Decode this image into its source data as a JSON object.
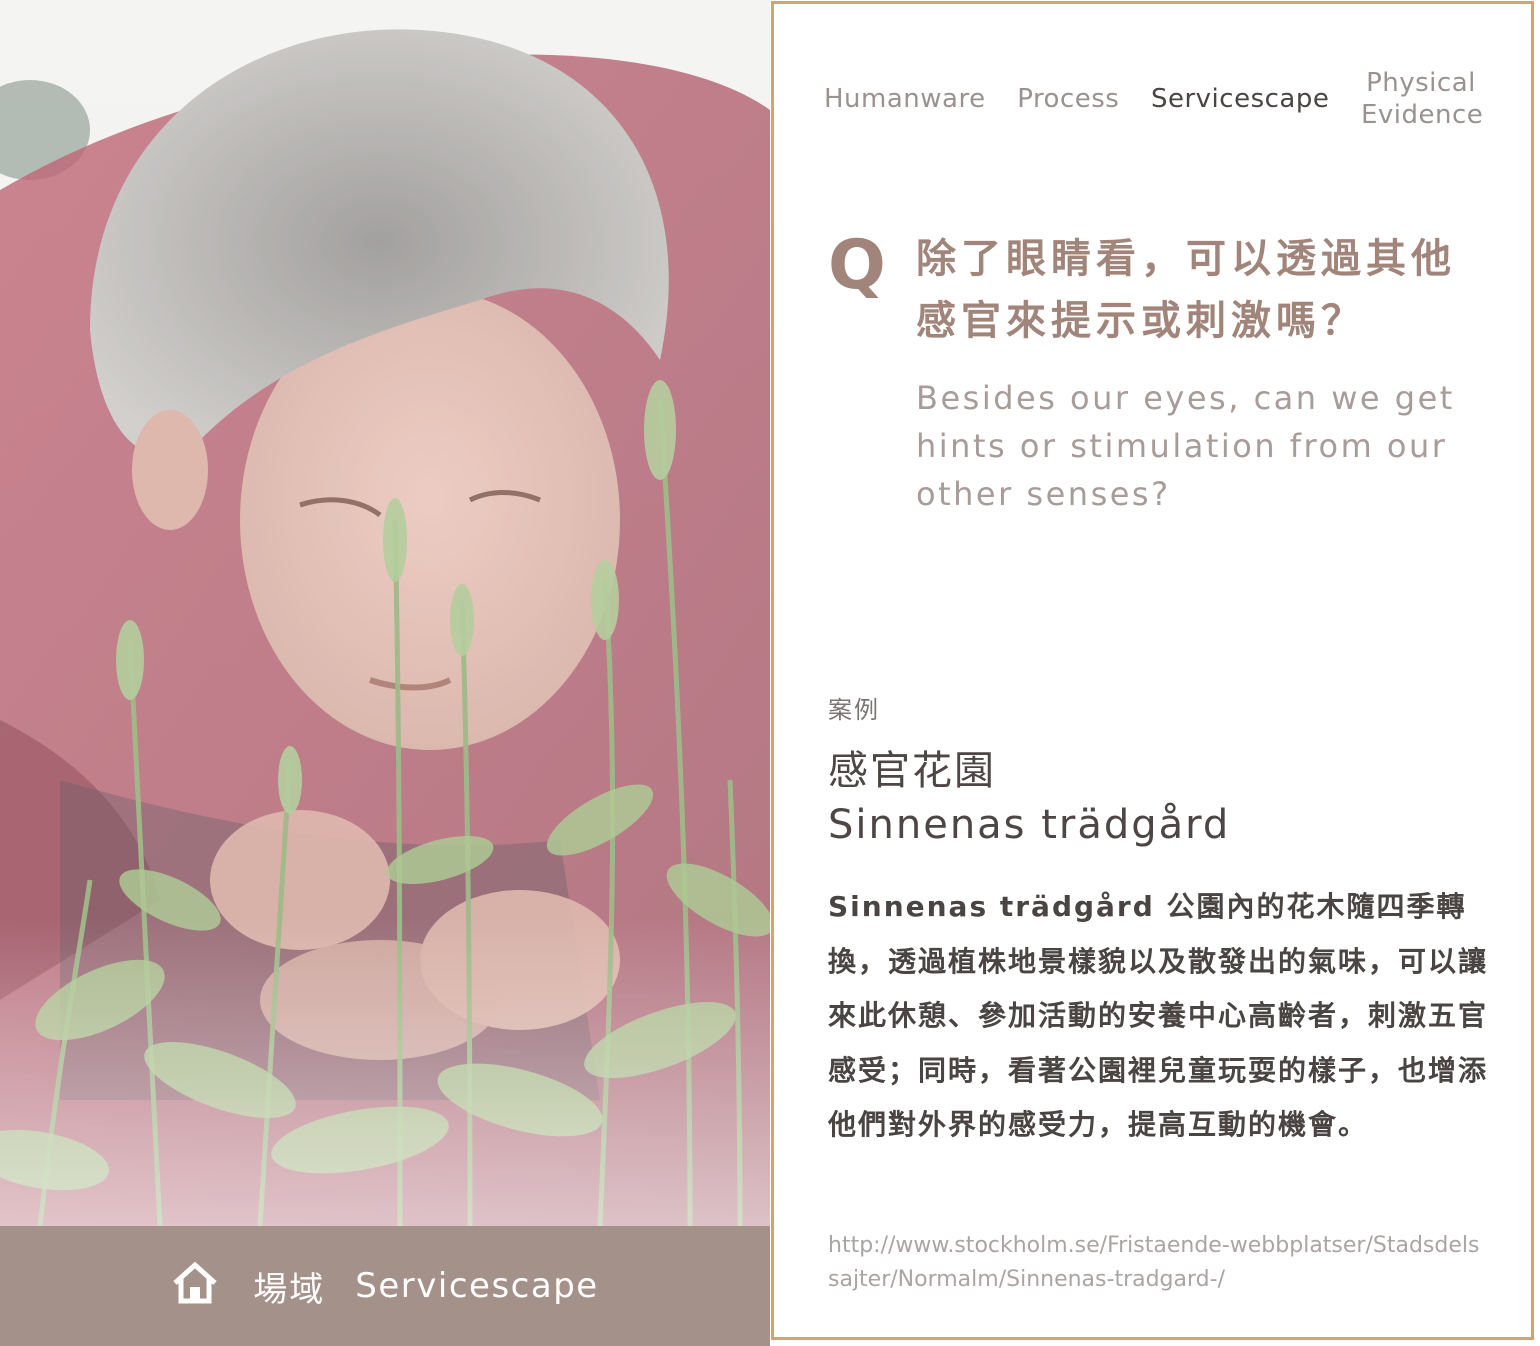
{
  "footer": {
    "icon": "home-icon",
    "label_zh": "場域",
    "label_en": "Servicescape",
    "background": "#a3918a"
  },
  "nav": {
    "tabs": [
      {
        "label": "Humanware",
        "active": false
      },
      {
        "label": "Process",
        "active": false
      },
      {
        "label": "Servicescape",
        "active": true
      },
      {
        "label": "Physical Evidence",
        "active": false
      }
    ]
  },
  "question": {
    "mark": "Q",
    "zh": "除了眼睛看，可以透過其他感官來提示或刺激嗎？",
    "en": "Besides our eyes, can we get hints or stimulation from our other senses?",
    "accent_color": "#a1857a"
  },
  "case": {
    "label": "案例",
    "title_zh": "感官花園",
    "title_en": "Sinnenas trädgård",
    "body": "Sinnenas trädgård 公園內的花木隨四季轉換，透過植株地景樣貌以及散發出的氣味，可以讓來此休憩、參加活動的安養中心高齡者，刺激五官感受；同時，看著公園裡兒童玩耍的樣子，也增添他們對外界的感受力，提高互動的機會。",
    "url": "http://www.stockholm.se/Fristaende-webbplatser/Stadsdelssajter/Normalm/Sinnenas-tradgard-/"
  },
  "colors": {
    "card_border": "#d4a56a"
  }
}
